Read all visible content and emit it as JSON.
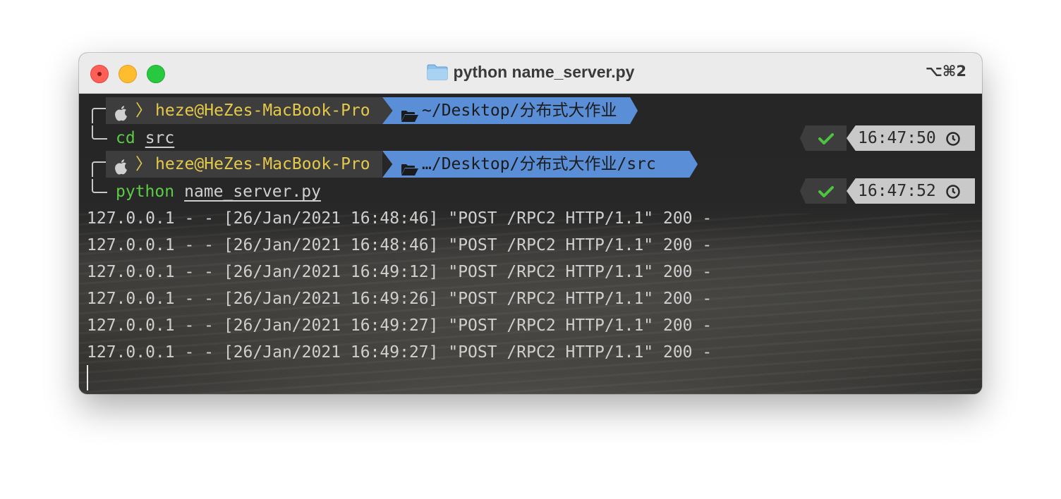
{
  "window": {
    "title": "python name_server.py",
    "shortcut": "⌥⌘2",
    "folder_icon": "folder-icon",
    "traffic_lights": {
      "close": "#fe5f57",
      "minimize": "#febc2e",
      "zoom": "#28c840"
    }
  },
  "prompts": [
    {
      "user": "heze@HeZes-MacBook-Pro",
      "path": "~/Desktop/分布式大作业",
      "command": "cd",
      "argument": "src",
      "status_icon": "check-icon",
      "time": "16:47:50",
      "time_icon": "clock-icon"
    },
    {
      "user": "heze@HeZes-MacBook-Pro",
      "path": "…/Desktop/分布式大作业/src",
      "command": "python",
      "argument": "name_server.py",
      "status_icon": "check-icon",
      "time": "16:47:52",
      "time_icon": "clock-icon"
    }
  ],
  "log_lines": [
    "127.0.0.1 - - [26/Jan/2021 16:48:46] \"POST /RPC2 HTTP/1.1\" 200 -",
    "127.0.0.1 - - [26/Jan/2021 16:48:46] \"POST /RPC2 HTTP/1.1\" 200 -",
    "127.0.0.1 - - [26/Jan/2021 16:49:12] \"POST /RPC2 HTTP/1.1\" 200 -",
    "127.0.0.1 - - [26/Jan/2021 16:49:26] \"POST /RPC2 HTTP/1.1\" 200 -",
    "127.0.0.1 - - [26/Jan/2021 16:49:27] \"POST /RPC2 HTTP/1.1\" 200 -",
    "127.0.0.1 - - [26/Jan/2021 16:49:27] \"POST /RPC2 HTTP/1.1\" 200 -"
  ],
  "colors": {
    "user_segment_text": "#e5c94a",
    "path_segment_bg": "#5a8fd7",
    "command_text": "#5ccb45",
    "log_text": "#cfcfcf"
  }
}
